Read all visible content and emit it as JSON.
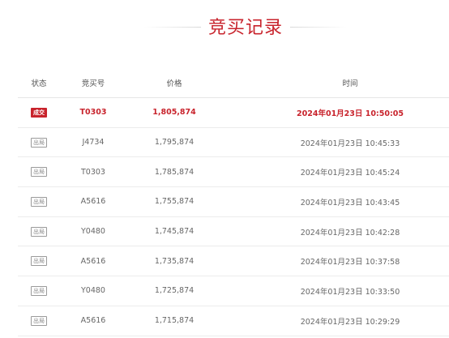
{
  "title": "竞买记录",
  "columns": {
    "status": "状态",
    "bidder": "竞买号",
    "price": "价格",
    "time": "时间"
  },
  "colors": {
    "accent": "#c8232c",
    "text": "#666666",
    "divider": "#ececec"
  },
  "rows": [
    {
      "status": "成交",
      "bidder": "T0303",
      "price": "1,805,874",
      "time": "2024年01月23日 10:50:05"
    },
    {
      "status": "出局",
      "bidder": "J4734",
      "price": "1,795,874",
      "time": "2024年01月23日 10:45:33"
    },
    {
      "status": "出局",
      "bidder": "T0303",
      "price": "1,785,874",
      "time": "2024年01月23日 10:45:24"
    },
    {
      "status": "出局",
      "bidder": "A5616",
      "price": "1,755,874",
      "time": "2024年01月23日 10:43:45"
    },
    {
      "status": "出局",
      "bidder": "Y0480",
      "price": "1,745,874",
      "time": "2024年01月23日 10:42:28"
    },
    {
      "status": "出局",
      "bidder": "A5616",
      "price": "1,735,874",
      "time": "2024年01月23日 10:37:58"
    },
    {
      "status": "出局",
      "bidder": "Y0480",
      "price": "1,725,874",
      "time": "2024年01月23日 10:33:50"
    },
    {
      "status": "出局",
      "bidder": "A5616",
      "price": "1,715,874",
      "time": "2024年01月23日 10:29:29"
    }
  ]
}
